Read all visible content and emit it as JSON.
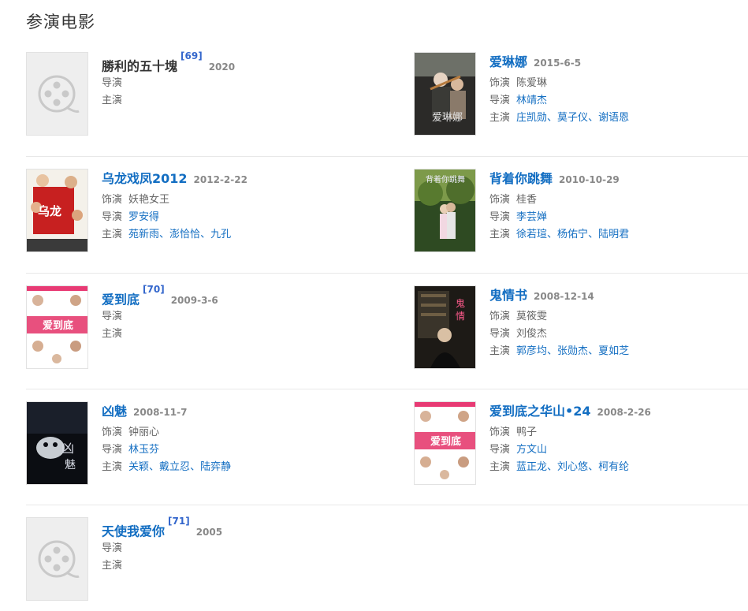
{
  "heading": "参演电影",
  "films": [
    {
      "title": "勝利的五十塊",
      "title_plain": true,
      "cite": "[69]",
      "date": "2020",
      "poster": "placeholder",
      "role_label": "",
      "role": "",
      "director_label": "导演",
      "directors": [],
      "cast_label": "主演",
      "cast": []
    },
    {
      "title": "爱琳娜",
      "title_plain": false,
      "cite": "",
      "date": "2015-6-5",
      "poster": "violin",
      "role_label": "饰演",
      "role": "陈爱琳",
      "director_label": "导演",
      "directors": [
        "林靖杰"
      ],
      "cast_label": "主演",
      "cast": [
        "庄凯勋",
        "莫子仪",
        "谢语恩"
      ]
    },
    {
      "title": "乌龙戏凤2012",
      "title_plain": false,
      "cite": "",
      "date": "2012-2-22",
      "poster": "comedy",
      "role_label": "饰演",
      "role": "妖艳女王",
      "director_label": "导演",
      "directors": [
        "罗安得"
      ],
      "cast_label": "主演",
      "cast": [
        "苑新雨",
        "澎恰恰",
        "九孔"
      ]
    },
    {
      "title": "背着你跳舞",
      "title_plain": false,
      "cite": "",
      "date": "2010-10-29",
      "poster": "forest",
      "role_label": "饰演",
      "role": "桂香",
      "director_label": "导演",
      "directors": [
        "李芸婵"
      ],
      "cast_label": "主演",
      "cast": [
        "徐若瑄",
        "杨佑宁",
        "陆明君"
      ]
    },
    {
      "title": "爱到底",
      "title_plain": false,
      "cite": "[70]",
      "date": "2009-3-6",
      "poster": "pink",
      "role_label": "",
      "role": "",
      "director_label": "导演",
      "directors": [],
      "cast_label": "主演",
      "cast": []
    },
    {
      "title": "鬼情书",
      "title_plain": false,
      "cite": "",
      "date": "2008-12-14",
      "poster": "library",
      "role_label": "饰演",
      "role": "莫筱雯",
      "director_label": "导演",
      "directors": [
        "刘俊杰"
      ],
      "directors_plain": true,
      "cast_label": "主演",
      "cast": [
        "郭彦均",
        "张勋杰",
        "夏如芝"
      ]
    },
    {
      "title": "凶魅",
      "title_plain": false,
      "cite": "",
      "date": "2008-11-7",
      "poster": "dark",
      "role_label": "饰演",
      "role": "钟丽心",
      "director_label": "导演",
      "directors": [
        "林玉芬"
      ],
      "cast_label": "主演",
      "cast": [
        "关颖",
        "戴立忍",
        "陆弈静"
      ]
    },
    {
      "title": "爱到底之华山•24",
      "title_plain": false,
      "cite": "",
      "date": "2008-2-26",
      "poster": "pink",
      "role_label": "饰演",
      "role": "鸭子",
      "director_label": "导演",
      "directors": [
        "方文山"
      ],
      "cast_label": "主演",
      "cast": [
        "蓝正龙",
        "刘心悠",
        "柯有纶"
      ]
    },
    {
      "title": "天使我爱你",
      "title_plain": false,
      "cite": "[71]",
      "date": "2005",
      "poster": "placeholder",
      "role_label": "",
      "role": "",
      "director_label": "导演",
      "directors": [],
      "cast_label": "主演",
      "cast": []
    }
  ]
}
